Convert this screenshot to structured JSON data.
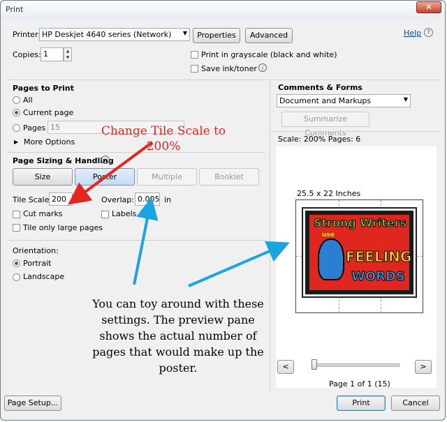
{
  "window": {
    "title": "Print",
    "help_link": "Help"
  },
  "printer": {
    "label": "Printer:",
    "value": "HP Deskjet 4640 series (Network)",
    "properties_button": "Properties",
    "advanced_button": "Advanced"
  },
  "copies": {
    "label": "Copies:",
    "value": "1"
  },
  "options": {
    "grayscale_label": "Print in grayscale (black and white)",
    "save_ink_label": "Save ink/toner"
  },
  "pages_to_print": {
    "title": "Pages to Print",
    "all_label": "All",
    "current_label": "Current page",
    "pages_label": "Pages",
    "pages_value": "15",
    "more_options": "More Options"
  },
  "sizing": {
    "title": "Page Sizing & Handling",
    "tabs": [
      "Size",
      "Poster",
      "Multiple",
      "Booklet"
    ],
    "tile_scale_label": "Tile Scale:",
    "tile_scale_value": "200",
    "tile_scale_unit": "%",
    "overlap_label": "Overlap:",
    "overlap_value": "0.005",
    "overlap_unit": "in",
    "cut_marks_label": "Cut marks",
    "labels_label": "Labels",
    "tile_large_label": "Tile only large pages"
  },
  "orientation": {
    "title": "Orientation:",
    "portrait_label": "Portrait",
    "landscape_label": "Landscape"
  },
  "comments": {
    "title": "Comments & Forms",
    "select_value": "Document and Markups",
    "summarize_button": "Summarize Comments"
  },
  "preview": {
    "scale_info": "Scale: 200% Pages: 6",
    "size_label": "25.5 x 22 Inches",
    "page_info": "Page 1 of 1 (15)",
    "prev": "<",
    "next": ">",
    "poster": {
      "line1": "Strong Writers",
      "line2": "use",
      "line3": "FEELING",
      "line4": "WORDS"
    }
  },
  "footer": {
    "page_setup_button": "Page Setup...",
    "print_button": "Print",
    "cancel_button": "Cancel"
  },
  "annotations": {
    "red_note": "Change Tile Scale to 200%",
    "blue_note": "You can toy around with these settings. The preview pane shows the actual number of pages that would make up the poster."
  },
  "colors": {
    "red_arrow": "#e5261f",
    "blue_arrow": "#1aa4e0",
    "poster_bg": "#e0271f",
    "poster_green": "#7cd32b",
    "poster_yellow": "#f6d314",
    "poster_blue": "#2b9de4"
  }
}
